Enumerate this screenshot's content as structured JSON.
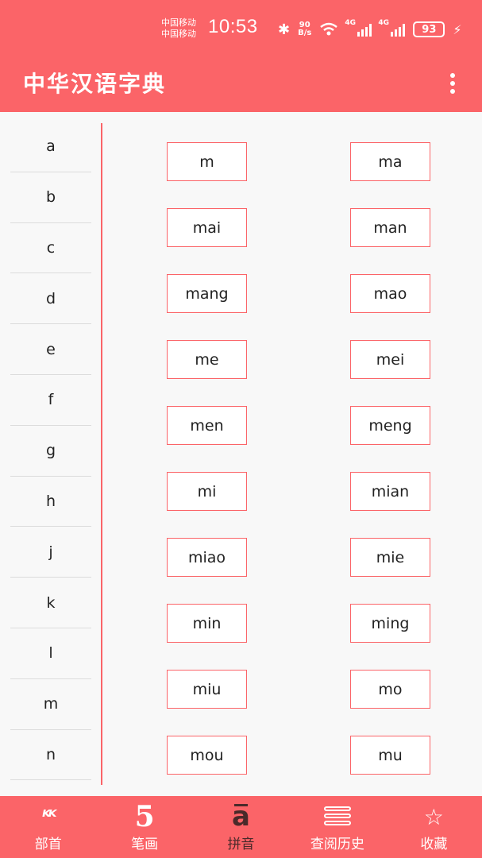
{
  "status_bar": {
    "carrier_1": "中国移动",
    "carrier_2": "中国移动",
    "time": "10:53",
    "net_speed_value": "90",
    "net_speed_unit": "B/s",
    "signal_1_tag": "4G",
    "signal_2_tag": "4G",
    "battery": "93"
  },
  "app_bar": {
    "title": "中华汉语字典",
    "more_icon": "more-vert-icon"
  },
  "letters": [
    "a",
    "b",
    "c",
    "d",
    "e",
    "f",
    "g",
    "h",
    "j",
    "k",
    "l",
    "m",
    "n"
  ],
  "syllables": [
    "m",
    "ma",
    "mai",
    "man",
    "mang",
    "mao",
    "me",
    "mei",
    "men",
    "meng",
    "mi",
    "mian",
    "miao",
    "mie",
    "min",
    "ming",
    "miu",
    "mo",
    "mou",
    "mu"
  ],
  "bottom_nav": [
    {
      "label": "部首",
      "icon": "radical-icon",
      "glyph": "ᴷᴷ"
    },
    {
      "label": "笔画",
      "icon": "stroke-icon",
      "glyph": "5"
    },
    {
      "label": "拼音",
      "icon": "pinyin-icon",
      "glyph": "a"
    },
    {
      "label": "查阅历史",
      "icon": "history-icon",
      "glyph": ""
    },
    {
      "label": "收藏",
      "icon": "favorite-icon",
      "glyph": "☆"
    }
  ],
  "colors": {
    "accent": "#fb6468",
    "active_tab": "#4a2a2a",
    "background": "#f8f8f8"
  }
}
